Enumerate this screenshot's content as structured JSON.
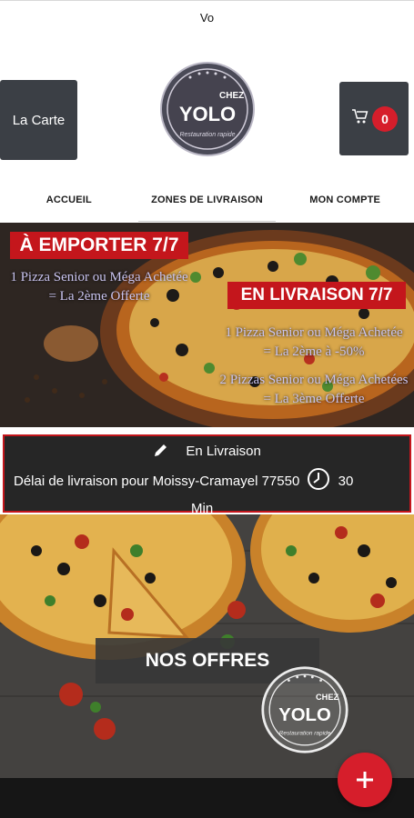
{
  "title": "Vo",
  "header": {
    "menu_label": "La Carte",
    "cart_count": "0",
    "logo": {
      "top": "CHEZ",
      "main": "YOLO",
      "tagline": "Restauration rapide"
    }
  },
  "nav": {
    "items": [
      {
        "label": "ACCUEIL"
      },
      {
        "label": "ZONES DE LIVRAISON"
      },
      {
        "label": "MON COMPTE"
      }
    ]
  },
  "promo": {
    "tag_takeaway": "À EMPORTER 7/7",
    "takeaway_line1": "1 Pizza Senior ou Méga Achetée",
    "takeaway_line2": "= La 2ème Offerte",
    "tag_delivery": "EN LIVRAISON 7/7",
    "delivery_line1": "1 Pizza Senior ou Méga Achetée",
    "delivery_line2": "= La 2ème à -50%",
    "delivery_line3": "2 Pizzas Senior ou Méga Achetées",
    "delivery_line4": "= La 3ème Offerte"
  },
  "delivery": {
    "mode": "En Livraison",
    "delay_text": "Délai de livraison pour Moissy-Cramayel 77550",
    "delay_value": "30",
    "delay_unit": "Min"
  },
  "offers": {
    "title": "NOS OFFRES"
  },
  "colors": {
    "accent": "#d61e2b",
    "dark": "#3b3f45",
    "panel": "#262626"
  }
}
